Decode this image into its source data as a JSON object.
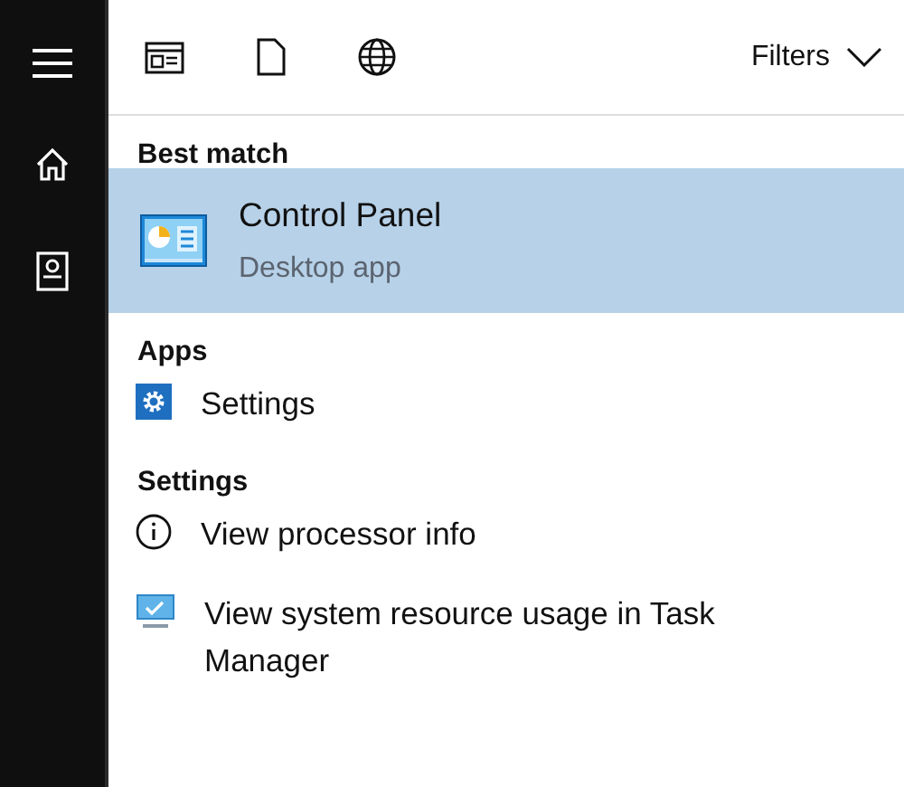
{
  "toolbar": {
    "filters": "Filters"
  },
  "sections": [
    {
      "header": "Best match",
      "items": [
        {
          "kind": "control-panel",
          "title": "Control Panel",
          "subtitle": "Desktop app",
          "selected": true
        }
      ]
    },
    {
      "header": "Apps",
      "items": [
        {
          "kind": "gear",
          "title": "Settings",
          "selected": false
        }
      ]
    },
    {
      "header": "Settings",
      "items": [
        {
          "kind": "info",
          "title": "View processor info",
          "selected": false
        },
        {
          "kind": "monitor",
          "title": "View system resource usage in Task Manager",
          "selected": false
        }
      ]
    }
  ]
}
